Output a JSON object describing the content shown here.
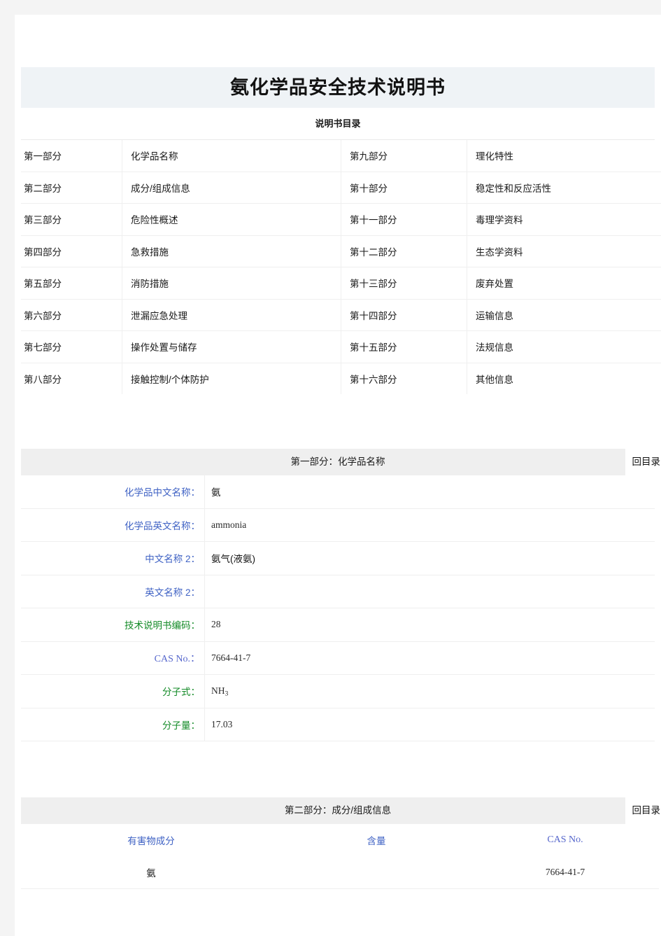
{
  "document": {
    "title": "氨化学品安全技术说明书",
    "toc_caption": "说明书目录",
    "back_link_label": "回目录"
  },
  "toc": {
    "rows": [
      {
        "left_no": "第一部分",
        "left_name": "化学品名称",
        "right_no": "第九部分",
        "right_name": "理化特性"
      },
      {
        "left_no": "第二部分",
        "left_name": "成分/组成信息",
        "right_no": "第十部分",
        "right_name": "稳定性和反应活性"
      },
      {
        "left_no": "第三部分",
        "left_name": "危险性概述",
        "right_no": "第十一部分",
        "right_name": "毒理学资料"
      },
      {
        "left_no": "第四部分",
        "left_name": "急救措施",
        "right_no": "第十二部分",
        "right_name": "生态学资料"
      },
      {
        "left_no": "第五部分",
        "left_name": "消防措施",
        "right_no": "第十三部分",
        "right_name": "废弃处置"
      },
      {
        "left_no": "第六部分",
        "left_name": "泄漏应急处理",
        "right_no": "第十四部分",
        "right_name": "运输信息"
      },
      {
        "left_no": "第七部分",
        "left_name": "操作处置与储存",
        "right_no": "第十五部分",
        "right_name": "法规信息"
      },
      {
        "left_no": "第八部分",
        "left_name": "接触控制/个体防护",
        "right_no": "第十六部分",
        "right_name": "其他信息"
      }
    ]
  },
  "section1": {
    "heading": "第一部分：化学品名称",
    "back_link_label": "回目录",
    "rows": [
      {
        "label": "化学品中文名称：",
        "value": "氨"
      },
      {
        "label": "化学品英文名称：",
        "value": "ammonia"
      },
      {
        "label": "中文名称 2：",
        "value": "氨气(液氨)"
      },
      {
        "label": "英文名称 2：",
        "value": ""
      },
      {
        "label": "技术说明书编码：",
        "value": "28"
      },
      {
        "label": "CAS No.：",
        "value": "7664-41-7"
      },
      {
        "label": "分子式：",
        "value": "NH3"
      },
      {
        "label": "分子量：",
        "value": "17.03"
      }
    ]
  },
  "section2": {
    "heading": "第二部分：成分/组成信息",
    "back_link_label": "回目录",
    "headers": {
      "component": "有害物成分",
      "content": "含量",
      "cas": "CAS No."
    },
    "rows": [
      {
        "component": "氨",
        "content": "",
        "cas": "7664-41-7"
      }
    ]
  },
  "colors": {
    "page_background": "#f4f4f4",
    "sheet_background": "#ffffff",
    "title_band": "#eff3f6",
    "section_head": "#efefef",
    "label_blue": "#3f62c4",
    "label_green": "#128a26",
    "border": "#efefef",
    "text": "#141414"
  }
}
